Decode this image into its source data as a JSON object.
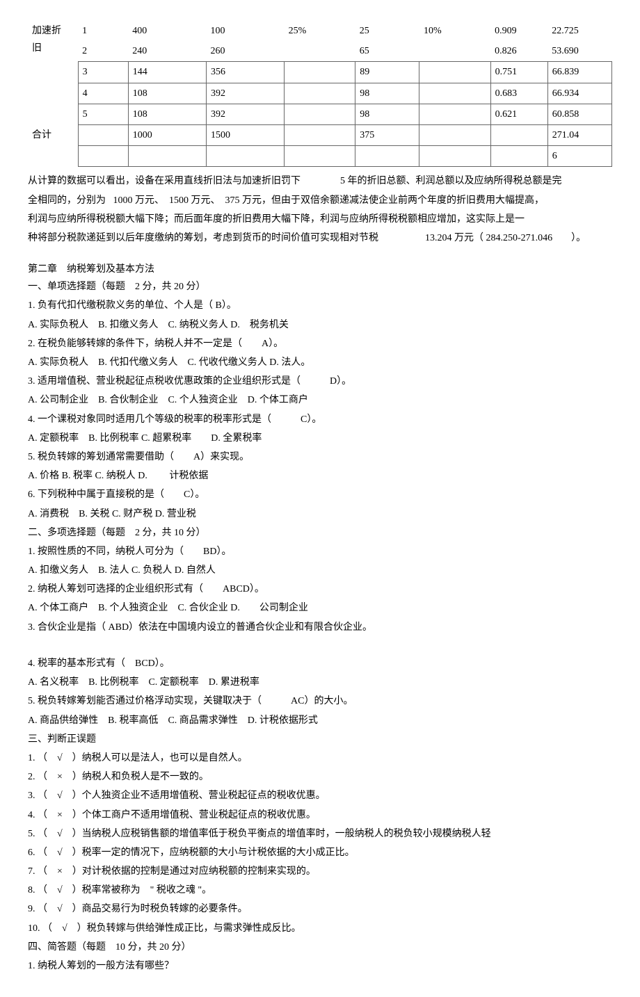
{
  "table": {
    "label1": "加速折",
    "label2": "旧",
    "label3": "合计",
    "rows": [
      {
        "c0": "1",
        "c1": "400",
        "c2": "100",
        "c3": "25%",
        "c4": "25",
        "c5": "10%",
        "c6": "0.909",
        "c7": "22.725"
      },
      {
        "c0": "2",
        "c1": "240",
        "c2": "260",
        "c3": "",
        "c4": "65",
        "c5": "",
        "c6": "0.826",
        "c7": "53.690"
      },
      {
        "c0": "3",
        "c1": "144",
        "c2": "356",
        "c3": "",
        "c4": "89",
        "c5": "",
        "c6": "0.751",
        "c7": "66.839"
      },
      {
        "c0": "4",
        "c1": "108",
        "c2": "392",
        "c3": "",
        "c4": "98",
        "c5": "",
        "c6": "0.683",
        "c7": "66.934"
      },
      {
        "c0": "5",
        "c1": "108",
        "c2": "392",
        "c3": "",
        "c4": "98",
        "c5": "",
        "c6": "0.621",
        "c7": "60.858"
      }
    ],
    "total": {
      "c0": "",
      "c1": "1000",
      "c2": "1500",
      "c3": "",
      "c4": "375",
      "c5": "",
      "c6": "",
      "c7": "271.04"
    },
    "tail": "6"
  },
  "paragraph": {
    "p1a": "从计算的数据可以看出，设备在采用直线折旧法与加速折旧罚下",
    "p1b": "5 年的折旧总额、利润总额以及应纳所得税总额是完",
    "p2a": "全相同的，分别为",
    "p2b": "1000 万元、",
    "p2c": "1500 万元、",
    "p2d": "375 万元，但由于双倍余额递减法使企业前两个年度的折旧费用大幅提高，",
    "p3": "利润与应纳所得税税额大幅下降；而后面年度的折旧费用大幅下降，利润与应纳所得税税额相应增加，这实际上是一",
    "p4a": "种将部分税款递延到以后年度缴纳的筹划，考虑到货币的时间价值可实现相对节税",
    "p4b": "13.204 万元（ 284.250-271.046",
    "p4c": "）。"
  },
  "chapter2": {
    "title": "第二章　纳税筹划及基本方法",
    "s1": {
      "header": "一、单项选择题（每题　2 分，共 20 分）",
      "q1": "1. 负有代扣代缴税款义务的单位、个人是（ B）。",
      "q1opts": "A. 实际负税人　B. 扣缴义务人　C. 纳税义务人  D.　税务机关",
      "q2": "2. 在税负能够转嫁的条件下，纳税人并不一定是（　　A）。",
      "q2opts": "A. 实际负税人　B. 代扣代缴义务人　C. 代收代缴义务人  D. 法人。",
      "q3": "3. 适用增值税、营业税起征点税收优惠政策的企业组织形式是（　　　D）。",
      "q3opts": "A. 公司制企业　B. 合伙制企业　C. 个人独资企业　D. 个体工商户",
      "q4": "4. 一个课税对象同时适用几个等级的税率的税率形式是（　　　C）。",
      "q4opts": "A. 定额税率　B. 比例税率  C. 超累税率　　D. 全累税率",
      "q5": "5. 税负转嫁的筹划通常需要借助（　　A）来实现。",
      "q5opts": "A. 价格  B. 税率  C. 纳税人  D. 　　计税依据",
      "q6": "6. 下列税种中属于直接税的是（　　C）。",
      "q6opts": "A. 消费税　B. 关税  C. 财产税  D. 营业税"
    },
    "s2": {
      "header": "二、多项选择题（每题　2 分，共 10 分）",
      "q1": "1. 按照性质的不同，纳税人可分为（　　BD）。",
      "q1opts": "A. 扣缴义务人　B. 法人  C. 负税人  D. 自然人",
      "q2": "2. 纳税人筹划可选择的企业组织形式有（　　ABCD）。",
      "q2opts": "A. 个体工商户　B. 个人独资企业　C. 合伙企业  D.　　公司制企业",
      "q3": "3. 合伙企业是指（ ABD）依法在中国境内设立的普通合伙企业和有限合伙企业。",
      "q4": "4. 税率的基本形式有（　BCD）。",
      "q4opts": "A. 名义税率　B. 比例税率　C. 定额税率　D. 累进税率",
      "q5": "5. 税负转嫁筹划能否通过价格浮动实现，关键取决于（　　　AC）的大小。",
      "q5opts": "A. 商品供给弹性　B. 税率高低　C. 商品需求弹性　D. 计税依据形式"
    },
    "s3": {
      "header": "三、判断正误题",
      "q1": "1. （　√　）纳税人可以是法人，也可以是自然人。",
      "q2": "2. （　×　）纳税人和负税人是不一致的。",
      "q3": "3. （　√　）个人独资企业不适用增值税、营业税起征点的税收优惠。",
      "q4": "4. （　×　）个体工商户不适用增值税、营业税起征点的税收优惠。",
      "q5": "5. （　√　）当纳税人应税销售额的增值率低于税负平衡点的增值率时，一般纳税人的税负较小规模纳税人轻",
      "q6": "6. （　√　）税率一定的情况下，应纳税额的大小与计税依据的大小成正比。",
      "q7": "7. （　×　）对计税依据的控制是通过对应纳税额的控制来实现的。",
      "q8": "8. （　√　）税率常被称为　\" 税收之魂 \"。",
      "q9": "9. （　√　）商品交易行为时税负转嫁的必要条件。",
      "q10": "10. （　√　）税负转嫁与供给弹性成正比，与需求弹性成反比。"
    },
    "s4": {
      "header": "四、简答题（每题　10 分，共 20 分）",
      "q1": "1. 纳税人筹划的一般方法有哪些？"
    }
  }
}
